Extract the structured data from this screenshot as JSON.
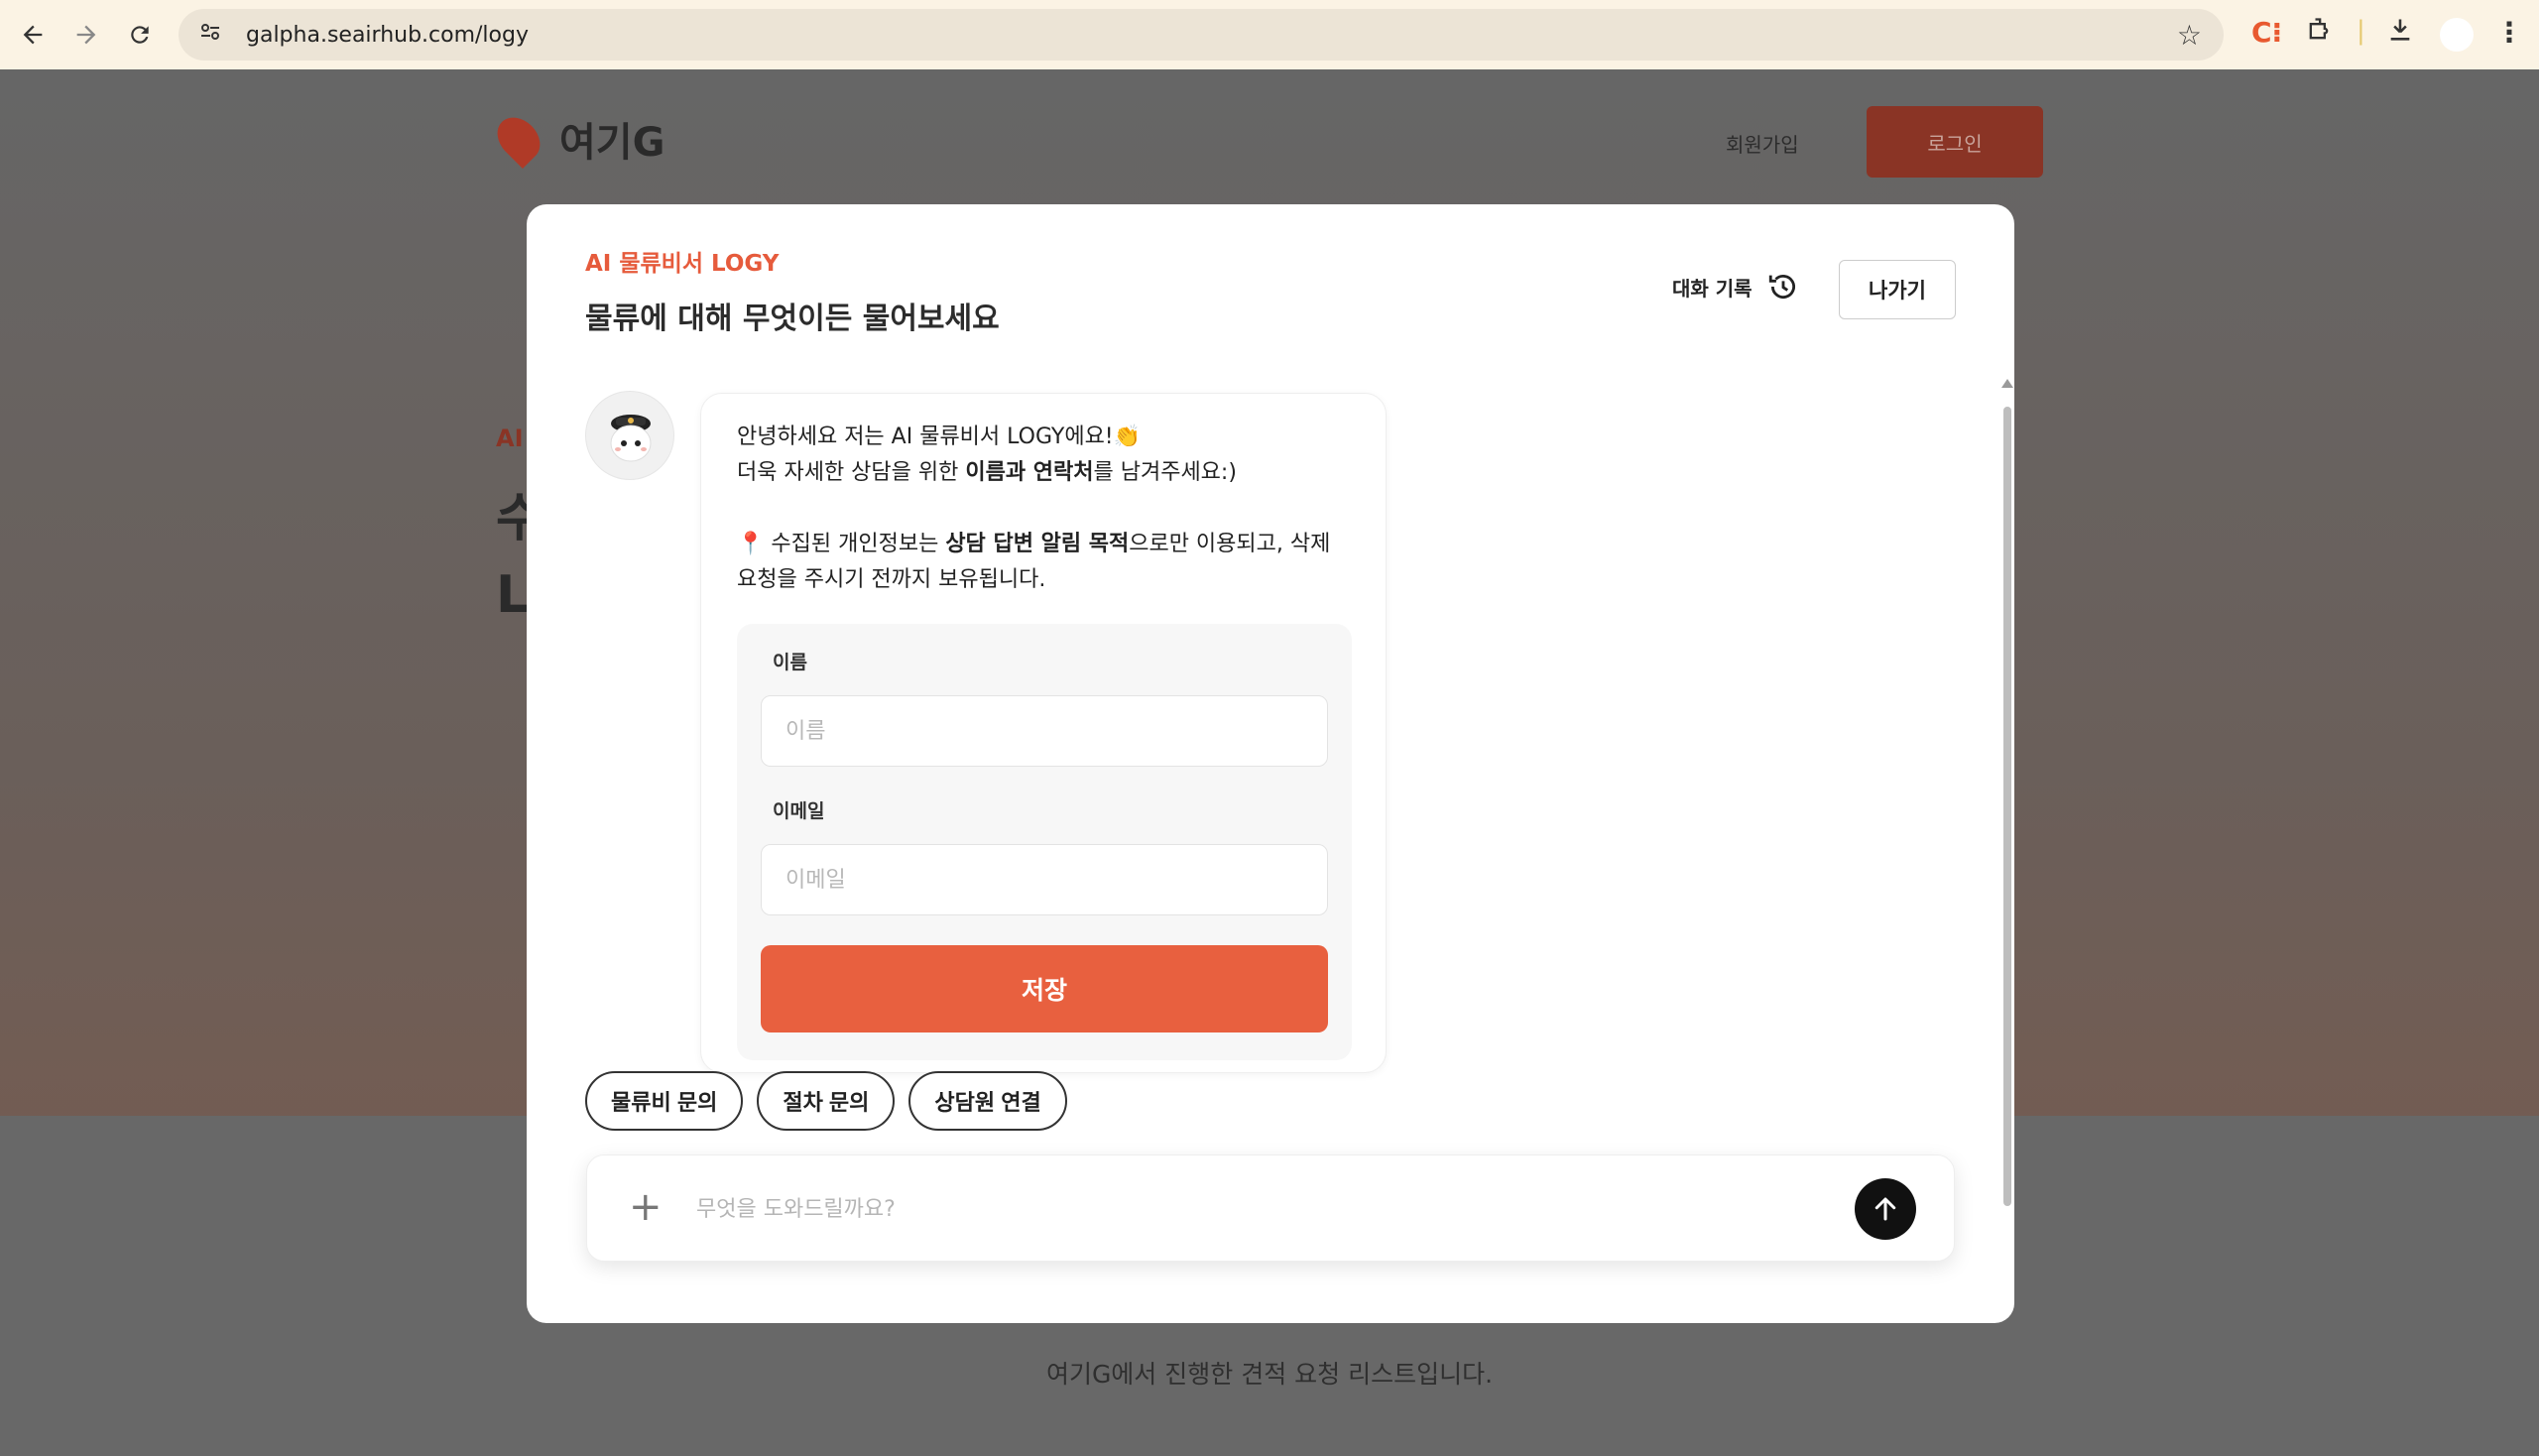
{
  "browser": {
    "url": "galpha.seairhub.com/logy",
    "extension_label": "C⁝"
  },
  "site": {
    "logo_text": "여기G",
    "signup_label": "회원가입",
    "login_label": "로그인",
    "bg_fragment_ai": "AI",
    "bg_fragment_1": "수",
    "bg_fragment_2": "L",
    "bg_subtitle": "여기G에서 진행한 견적 요청 리스트입니다."
  },
  "modal": {
    "eyebrow": "AI 물류비서 LOGY",
    "headline": "물류에 대해 무엇이든 물어보세요",
    "history_label": "대화 기록",
    "exit_label": "나가기"
  },
  "message": {
    "line1": "안녕하세요 저는 AI 물류비서 LOGY에요!",
    "line1_emoji": "👏",
    "line2_prefix": "더욱 자세한 상담을 위한 ",
    "line2_bold": "이름과 연락처",
    "line2_suffix": "를 남겨주세요:)",
    "notice_icon": "📍",
    "line3_prefix": " 수집된 개인정보는 ",
    "line3_bold": "상담 답변 알림 목적",
    "line3_suffix": "으로만 이용되고, 삭제",
    "line4": "요청을 주시기 전까지 보유됩니다."
  },
  "form": {
    "name_label": "이름",
    "name_placeholder": "이름",
    "name_value": "",
    "email_label": "이메일",
    "email_placeholder": "이메일",
    "email_value": "",
    "save_label": "저장"
  },
  "quick_replies": [
    "물류비 문의",
    "절차 문의",
    "상담원 연결"
  ],
  "composer": {
    "placeholder": "무엇을 도와드릴까요?",
    "value": ""
  },
  "colors": {
    "accent": "#e8603f",
    "eyebrow": "#e65b3c",
    "send_button": "#111111"
  }
}
